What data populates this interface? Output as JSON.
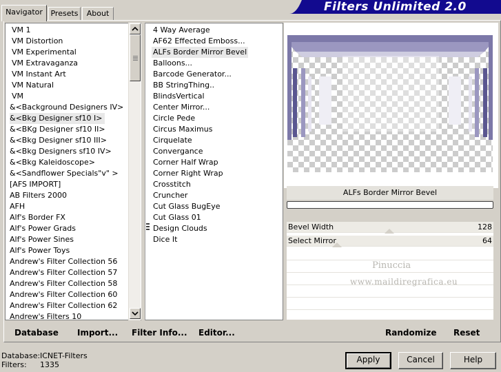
{
  "tabs": [
    "Navigator",
    "Presets",
    "About"
  ],
  "app_title": "Filters Unlimited 2.0",
  "categories": [
    "VM 1",
    "VM Distortion",
    "VM Experimental",
    "VM Extravaganza",
    "VM Instant Art",
    "VM Natural",
    "VM",
    "&<Background Designers IV>",
    "&<Bkg Designer sf10 I>",
    "&<BKg Designer sf10 II>",
    "&<Bkg Designer sf10 III>",
    "&<Bkg Designers sf10 IV>",
    "&<Bkg Kaleidoscope>",
    "&<Sandflower Specials\"v\" >",
    "[AFS IMPORT]",
    "AB Filters 2000",
    "AFH",
    "Alf's Border FX",
    "Alf's Power Grads",
    "Alf's Power Sines",
    "Alf's Power Toys",
    "Andrew's Filter Collection 56",
    "Andrew's Filter Collection 57",
    "Andrew's Filter Collection 58",
    "Andrew's Filter Collection 60",
    "Andrew's Filter Collection 62",
    "Andrew's Filters 10"
  ],
  "selected_category_index": 8,
  "filters": [
    "4 Way Average",
    "AF62 Effected Emboss...",
    "ALFs Border Mirror Bevel",
    "Balloons...",
    "Barcode Generator...",
    "BB StringThing..",
    "BlindsVertical",
    "Center Mirror...",
    "Circle Pede",
    "Circus Maximus",
    "Cirquelate",
    "Convergance",
    "Corner Half Wrap",
    "Corner Right Wrap",
    "Crosstitch",
    "Cruncher",
    "Cut Glass  BugEye",
    "Cut Glass 01",
    "Design Clouds",
    "Dice It"
  ],
  "selected_filter_index": 2,
  "filter_name": "ALFs Border Mirror Bevel",
  "params": [
    {
      "label": "Bevel Width",
      "value": "128"
    },
    {
      "label": "Select Mirror",
      "value": "64"
    }
  ],
  "watermark": [
    "Pinuccia",
    "www.maildiregrafica.eu"
  ],
  "actions": {
    "database": "Database",
    "import": "Import...",
    "filter_info": "Filter Info...",
    "editor": "Editor...",
    "randomize": "Randomize",
    "reset": "Reset"
  },
  "footer": {
    "database_label": "Database:",
    "database_value": "ICNET-Filters",
    "filters_label": "Filters:",
    "filters_value": "1335"
  },
  "buttons": {
    "apply": "Apply",
    "cancel": "Cancel",
    "help": "Help"
  },
  "colors": {
    "banner": "#120a8f",
    "preview_border": "#7c78a8",
    "accent_dark": "#5a5690"
  }
}
